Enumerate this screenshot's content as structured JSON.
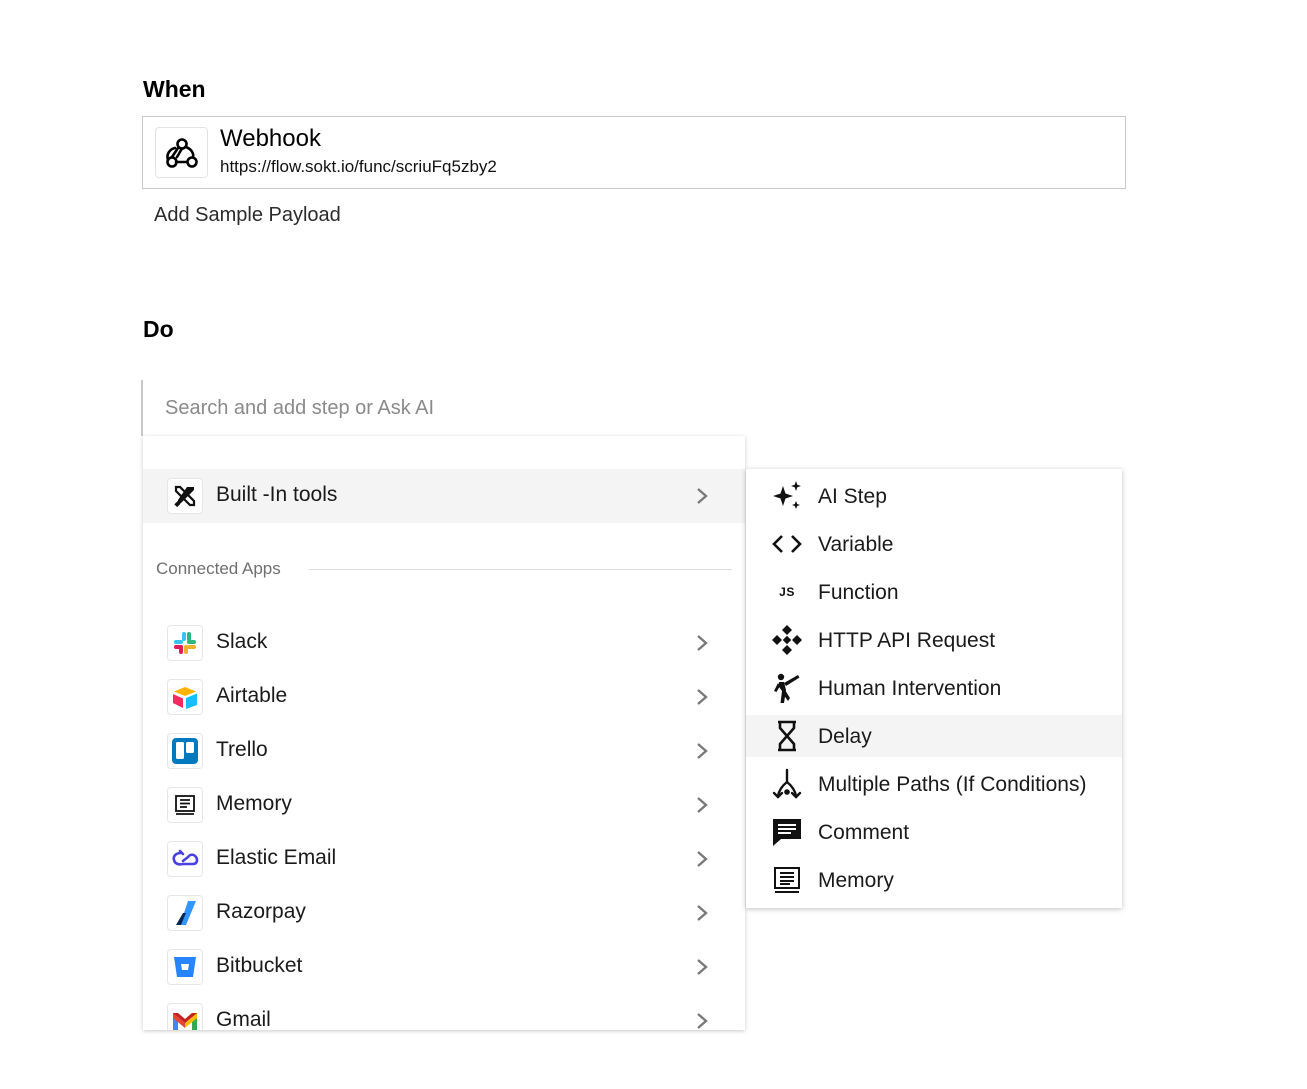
{
  "trigger_section": {
    "title": "When",
    "trigger": {
      "name": "Webhook",
      "url": "https://flow.sokt.io/func/scriuFq5zby2",
      "icon": "webhook-icon"
    },
    "sample_link": "Add Sample Payload"
  },
  "do_section": {
    "title": "Do",
    "search": {
      "placeholder": "Search and add step or Ask AI",
      "value": ""
    }
  },
  "menu": {
    "builtin": {
      "label": "Built -In tools",
      "icon": "tools-icon"
    },
    "connected_label": "Connected Apps",
    "apps": [
      {
        "label": "Slack",
        "icon": "slack-icon"
      },
      {
        "label": "Airtable",
        "icon": "airtable-icon"
      },
      {
        "label": "Trello",
        "icon": "trello-icon"
      },
      {
        "label": "Memory",
        "icon": "memory-icon"
      },
      {
        "label": "Elastic Email",
        "icon": "elastic-email-icon"
      },
      {
        "label": "Razorpay",
        "icon": "razorpay-icon"
      },
      {
        "label": "Bitbucket",
        "icon": "bitbucket-icon"
      },
      {
        "label": "Gmail",
        "icon": "gmail-icon"
      }
    ]
  },
  "submenu": {
    "items": [
      {
        "label": "AI Step",
        "icon": "sparkles-icon"
      },
      {
        "label": "Variable",
        "icon": "code-brackets-icon"
      },
      {
        "label": "Function",
        "icon": "js-icon",
        "icon_text": "JS"
      },
      {
        "label": "HTTP API Request",
        "icon": "api-icon"
      },
      {
        "label": "Human Intervention",
        "icon": "human-icon"
      },
      {
        "label": "Delay",
        "icon": "hourglass-icon"
      },
      {
        "label": "Multiple Paths (If Conditions)",
        "icon": "fork-icon"
      },
      {
        "label": "Comment",
        "icon": "comment-icon"
      },
      {
        "label": "Memory",
        "icon": "memory-icon"
      }
    ],
    "active_label": "Delay"
  },
  "colors": {
    "row_highlight": "#f4f4f4",
    "border": "#c9c9c9",
    "muted_text": "#6f6f6f"
  }
}
